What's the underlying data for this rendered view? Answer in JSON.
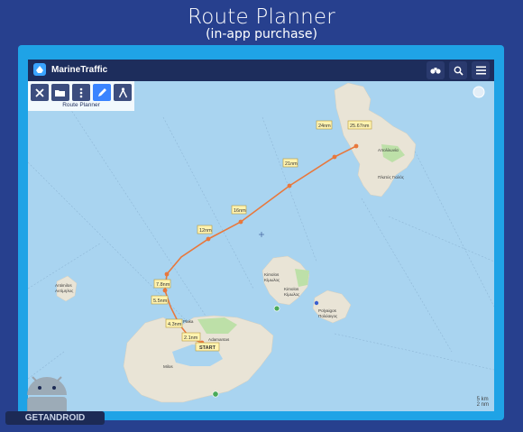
{
  "header": {
    "title": "Route Planner",
    "subtitle": "(in-app purchase)"
  },
  "app": {
    "brand": "MarineTraffic",
    "actions": [
      {
        "icon": "binoculars-icon"
      },
      {
        "icon": "search-icon"
      },
      {
        "icon": "menu-icon"
      }
    ]
  },
  "toolbar": {
    "caption": "Route Planner",
    "tools": [
      {
        "icon": "close-icon",
        "active": false
      },
      {
        "icon": "folder-icon",
        "active": false
      },
      {
        "icon": "more-vertical-icon",
        "active": false
      },
      {
        "icon": "pencil-icon",
        "active": true
      },
      {
        "icon": "compass-icon",
        "active": false
      }
    ]
  },
  "route": {
    "start_label": "START",
    "waypoints": [
      "2.1nm",
      "4.3nm",
      "5.5nm",
      "7.8nm",
      "12nm",
      "16nm",
      "21nm",
      "24nm",
      "25.67nm"
    ]
  },
  "map_places": [
    "Απολλωνία",
    "Πλατύς Γιαλός",
    "Kimolos",
    "Κίμωλος",
    "Polyaigos",
    "Πολύαιγος",
    "Milos",
    "Adamantas",
    "Antimilos",
    "Αντίμηλος",
    "Plaka",
    "Kastro"
  ],
  "scale": {
    "top": "5 km",
    "bottom": "2 nm"
  },
  "watermark": "GETANDROID",
  "colors": {
    "sea": "#a9d4f0",
    "land": "#e8e4d8",
    "route": "#e8783c",
    "appbar": "#1d2d5c",
    "frame": "#1fa3e6",
    "background": "#27408e"
  }
}
